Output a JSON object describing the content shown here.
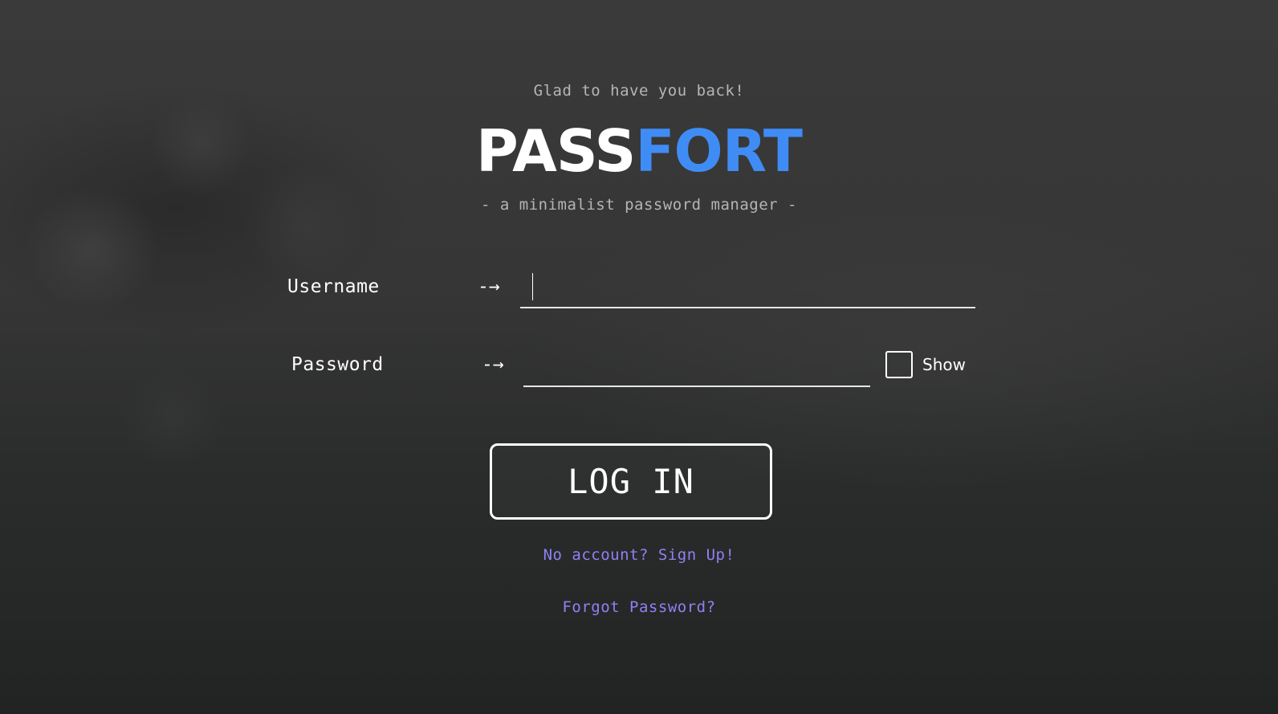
{
  "header": {
    "tagline": "Glad to have you back!",
    "logo_part1": "PASS",
    "logo_part2": "FORT",
    "subtitle": "- a minimalist password manager -"
  },
  "form": {
    "username_label": "Username",
    "username_arrow": "-→",
    "username_value": "",
    "password_label": "Password",
    "password_arrow": "-→",
    "password_value": "",
    "show_label": "Show",
    "show_checked": false,
    "login_button": "LOG IN"
  },
  "links": {
    "signup": "No account? Sign Up!",
    "forgot": "Forgot Password?"
  },
  "colors": {
    "accent_blue": "#3f8cf5",
    "link_purple": "#8e82f3"
  }
}
